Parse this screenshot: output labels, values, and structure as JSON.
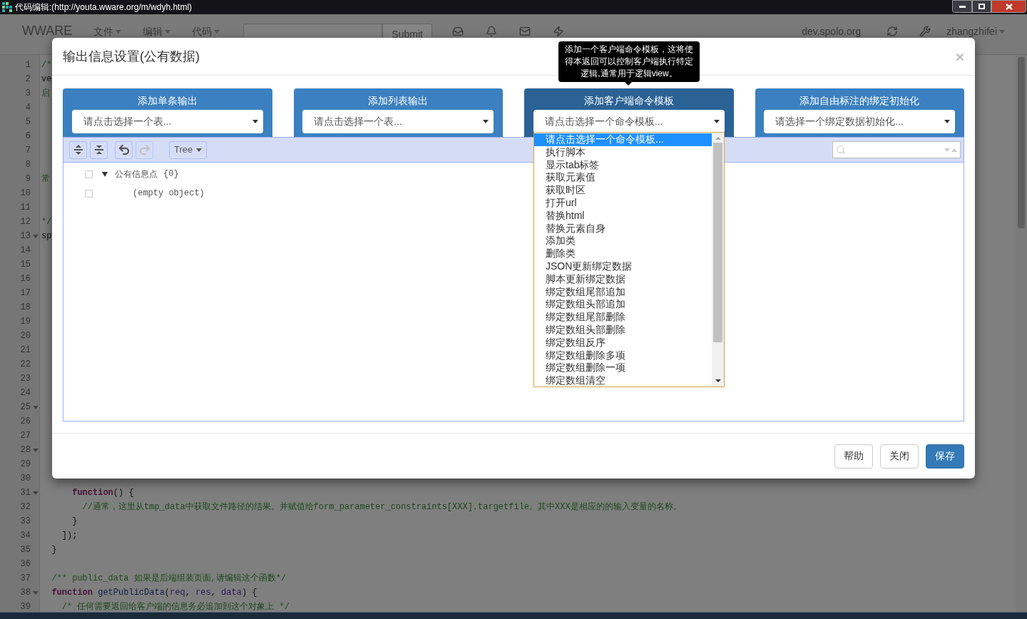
{
  "window": {
    "title": "代码编辑:(http://youta.wware.org/m/wdyh.html)"
  },
  "navbar": {
    "brand": "WWARE",
    "menus": [
      "文件",
      "编辑",
      "代码"
    ],
    "submit": "Submit",
    "host": "dev.spolo.org",
    "user": "zhangzhifei"
  },
  "editor": {
    "lines": [
      {
        "number": "1",
        "foldable": false,
        "tokens": [
          {
            "text": "/*",
            "kind": "comment"
          }
        ]
      },
      {
        "number": "2",
        "foldable": false,
        "tokens": [
          {
            "text": "ve",
            "kind": "plain"
          }
        ]
      },
      {
        "number": "3",
        "foldable": false,
        "tokens": [
          {
            "text": "启",
            "kind": "comment"
          }
        ]
      },
      {
        "number": "4",
        "foldable": false
      },
      {
        "number": "5",
        "foldable": false
      },
      {
        "number": "6",
        "foldable": false
      },
      {
        "number": "7",
        "foldable": false
      },
      {
        "number": "8",
        "foldable": false
      },
      {
        "number": "9",
        "foldable": false,
        "tokens": [
          {
            "text": "常",
            "kind": "comment"
          }
        ]
      },
      {
        "number": "10",
        "foldable": false
      },
      {
        "number": "11",
        "foldable": false
      },
      {
        "number": "12",
        "foldable": false,
        "tokens": [
          {
            "text": "*/",
            "kind": "comment"
          }
        ]
      },
      {
        "number": "13",
        "foldable": true,
        "tokens": [
          {
            "text": "sp",
            "kind": "plain"
          }
        ]
      },
      {
        "number": "14",
        "foldable": false
      },
      {
        "number": "15",
        "foldable": false
      },
      {
        "number": "16",
        "foldable": false
      },
      {
        "number": "17",
        "foldable": false
      },
      {
        "number": "18",
        "foldable": false
      },
      {
        "number": "19",
        "foldable": false
      },
      {
        "number": "20",
        "foldable": false
      },
      {
        "number": "21",
        "foldable": false
      },
      {
        "number": "22",
        "foldable": false
      },
      {
        "number": "23",
        "foldable": false
      },
      {
        "number": "24",
        "foldable": false
      },
      {
        "number": "25",
        "foldable": true
      },
      {
        "number": "26",
        "foldable": false
      },
      {
        "number": "27",
        "foldable": false
      },
      {
        "number": "28",
        "foldable": true
      },
      {
        "number": "29",
        "foldable": false
      },
      {
        "number": "30",
        "foldable": false
      },
      {
        "number": "31",
        "foldable": true,
        "tokens": [
          {
            "text": "      function",
            "kind": "keyword"
          },
          {
            "text": "() {",
            "kind": "plain"
          }
        ]
      },
      {
        "number": "32",
        "foldable": false,
        "tokens": [
          {
            "text": "        //通常，这里从tmp_data中获取文件路径的结果。并赋值给form_parameter_constraints[XXX].targetfile。其中XXX是相应的的输入变量的名称。",
            "kind": "comment"
          }
        ]
      },
      {
        "number": "33",
        "foldable": false,
        "tokens": [
          {
            "text": "      }",
            "kind": "plain"
          }
        ]
      },
      {
        "number": "34",
        "foldable": false,
        "tokens": [
          {
            "text": "    ]);",
            "kind": "plain"
          }
        ]
      },
      {
        "number": "35",
        "foldable": false,
        "tokens": [
          {
            "text": "  }",
            "kind": "plain"
          }
        ]
      },
      {
        "number": "36",
        "foldable": false
      },
      {
        "number": "37",
        "foldable": false,
        "tokens": [
          {
            "text": "  /** public_data 如果是后端组装页面,请编辑这个函数*/",
            "kind": "comment"
          }
        ]
      },
      {
        "number": "38",
        "foldable": true,
        "tokens": [
          {
            "text": "  function",
            "kind": "keyword"
          },
          {
            "text": " getPublicData",
            "kind": "name"
          },
          {
            "text": "(",
            "kind": "plain"
          },
          {
            "text": "req",
            "kind": "variable"
          },
          {
            "text": ", ",
            "kind": "plain"
          },
          {
            "text": "res",
            "kind": "variable"
          },
          {
            "text": ", ",
            "kind": "plain"
          },
          {
            "text": "data",
            "kind": "variable"
          },
          {
            "text": ") {",
            "kind": "plain"
          }
        ]
      },
      {
        "number": "39",
        "foldable": false,
        "tokens": [
          {
            "text": "    /* 任何需要返回给客户端的信息务必追加到这个对象上 */",
            "kind": "comment"
          }
        ]
      }
    ]
  },
  "dialog": {
    "title": "输出信息设置(公有数据)",
    "close": "×",
    "tooltip": "添加一个客户端命令模板，这将使得本返回可以控制客户端执行特定逻辑,通常用于逻辑view。",
    "panels": [
      {
        "title": "添加单条输出",
        "value": "请点击选择一个表...",
        "highlighted": false
      },
      {
        "title": "添加列表输出",
        "value": "请点击选择一个表...",
        "highlighted": false
      },
      {
        "title": "添加客户端命令模板",
        "value": "请点击选择一个命令模板...",
        "highlighted": true
      },
      {
        "title": "添加自由标注的绑定初始化",
        "value": "请选择一个绑定数据初始化...",
        "highlighted": false
      }
    ],
    "dropdown": {
      "items": [
        {
          "label": "请点击选择一个命令模板...",
          "selected": true
        },
        {
          "label": "执行脚本",
          "selected": false
        },
        {
          "label": "显示tab标签",
          "selected": false
        },
        {
          "label": "获取元素值",
          "selected": false
        },
        {
          "label": "获取时区",
          "selected": false
        },
        {
          "label": "打开url",
          "selected": false
        },
        {
          "label": "替换html",
          "selected": false
        },
        {
          "label": "替换元素自身",
          "selected": false
        },
        {
          "label": "添加类",
          "selected": false
        },
        {
          "label": "删除类",
          "selected": false
        },
        {
          "label": "JSON更新绑定数据",
          "selected": false
        },
        {
          "label": "脚本更新绑定数据",
          "selected": false
        },
        {
          "label": "绑定数组尾部追加",
          "selected": false
        },
        {
          "label": "绑定数组头部追加",
          "selected": false
        },
        {
          "label": "绑定数组尾部删除",
          "selected": false
        },
        {
          "label": "绑定数组头部删除",
          "selected": false
        },
        {
          "label": "绑定数组反序",
          "selected": false
        },
        {
          "label": "绑定数组删除多项",
          "selected": false
        },
        {
          "label": "绑定数组删除一项",
          "selected": false
        },
        {
          "label": "绑定数组清空",
          "selected": false
        }
      ]
    },
    "json_editor": {
      "tools": [
        {
          "kind": "expand",
          "disabled": false
        },
        {
          "kind": "collapse",
          "disabled": false
        },
        {
          "kind": "undo",
          "disabled": false
        },
        {
          "kind": "redo",
          "disabled": true
        }
      ],
      "mode": "Tree",
      "tree": [
        {
          "label": "公有信息点",
          "count": "{0}",
          "expanded": true,
          "children": [
            {
              "label": "(empty object)"
            }
          ]
        }
      ]
    },
    "buttons": [
      {
        "label": "帮助",
        "primary": false
      },
      {
        "label": "关闭",
        "primary": false
      },
      {
        "label": "保存",
        "primary": true
      }
    ]
  }
}
